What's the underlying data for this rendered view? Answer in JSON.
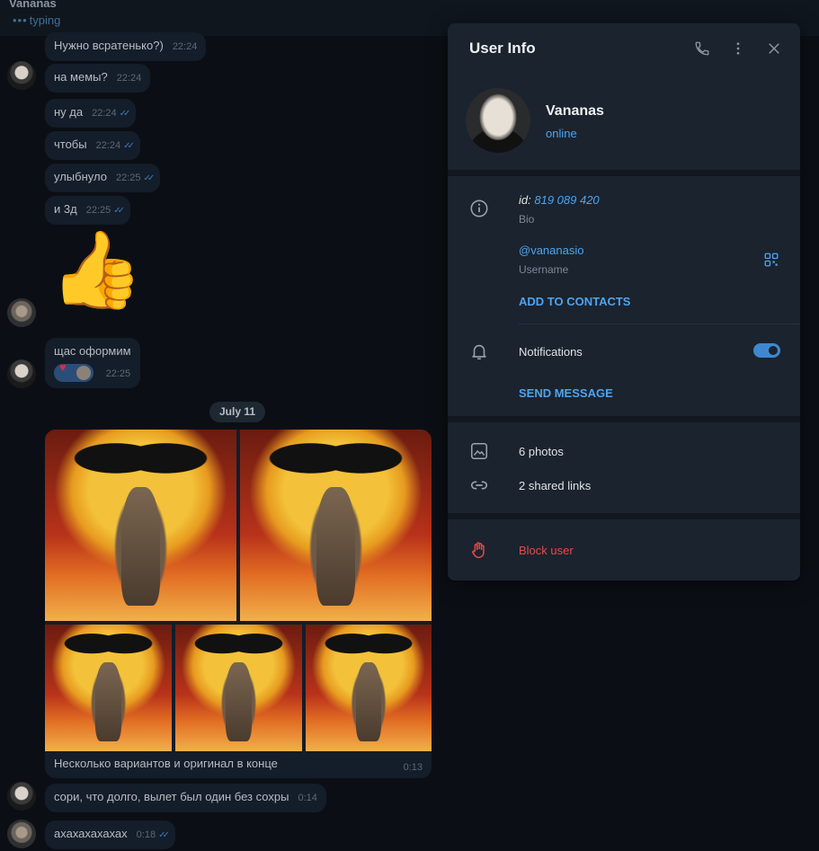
{
  "chat": {
    "title": "Vananas",
    "status": "typing",
    "messages": [
      {
        "text": "Нужно всратенько?)",
        "time": "22:24"
      },
      {
        "text": "на мемы?",
        "time": "22:24"
      },
      {
        "text": "ну да",
        "time": "22:24"
      },
      {
        "text": "чтобы",
        "time": "22:24"
      },
      {
        "text": "улыбнуло",
        "time": "22:25"
      },
      {
        "text": "и 3д",
        "time": "22:25"
      },
      {
        "text": "щас оформим",
        "time": "22:25"
      }
    ],
    "date_divider": "July 11",
    "media_caption": "Несколько вариантов и оригинал в конце",
    "media_time": "0:13",
    "later_messages": [
      {
        "text": "сори, что долго, вылет был один без сохры",
        "time": "0:14"
      },
      {
        "text": "ахахахахахах",
        "time": "0:18"
      }
    ]
  },
  "panel": {
    "title": "User Info",
    "name": "Vananas",
    "status": "online",
    "id_label": "id:",
    "id_value": "819 089 420",
    "bio_label": "Bio",
    "username": "@vananasio",
    "username_label": "Username",
    "add_contacts": "ADD TO CONTACTS",
    "notifications": "Notifications",
    "notifications_on": true,
    "send_message": "SEND MESSAGE",
    "photos": "6 photos",
    "links": "2 shared links",
    "block": "Block user"
  },
  "colors": {
    "accent": "#4ea4f0",
    "danger": "#e84a4a",
    "panel": "#1b232e"
  }
}
